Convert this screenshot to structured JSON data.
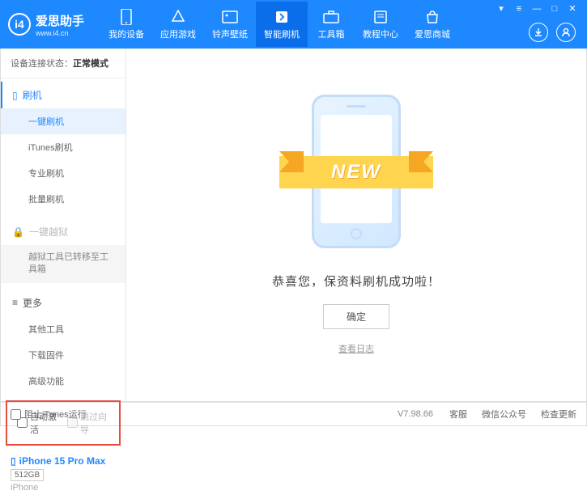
{
  "header": {
    "logo_title": "爱思助手",
    "logo_url": "www.i4.cn",
    "tabs": [
      {
        "label": "我的设备"
      },
      {
        "label": "应用游戏"
      },
      {
        "label": "铃声壁纸"
      },
      {
        "label": "智能刷机"
      },
      {
        "label": "工具箱"
      },
      {
        "label": "教程中心"
      },
      {
        "label": "爱思商城"
      }
    ]
  },
  "sidebar": {
    "device_status_label": "设备连接状态：",
    "device_status_value": "正常模式",
    "flash_header": "刷机",
    "flash_items": {
      "onekey": "一键刷机",
      "itunes": "iTunes刷机",
      "pro": "专业刷机",
      "batch": "批量刷机"
    },
    "jailbreak_header": "一键越狱",
    "jailbreak_note": "越狱工具已转移至工具箱",
    "more_header": "更多",
    "more_items": {
      "other": "其他工具",
      "download": "下载固件",
      "advanced": "高级功能"
    },
    "checkboxes": {
      "auto_activate": "自动激活",
      "skip_guide": "跳过向导"
    },
    "device": {
      "name": "iPhone 15 Pro Max",
      "storage": "512GB",
      "type": "iPhone"
    }
  },
  "main": {
    "new_label": "NEW",
    "success_msg": "恭喜您，保资料刷机成功啦！",
    "confirm_btn": "确定",
    "view_log": "查看日志"
  },
  "footer": {
    "block_itunes": "阻止iTunes运行",
    "version": "V7.98.66",
    "links": {
      "service": "客服",
      "wechat": "微信公众号",
      "update": "检查更新"
    }
  }
}
